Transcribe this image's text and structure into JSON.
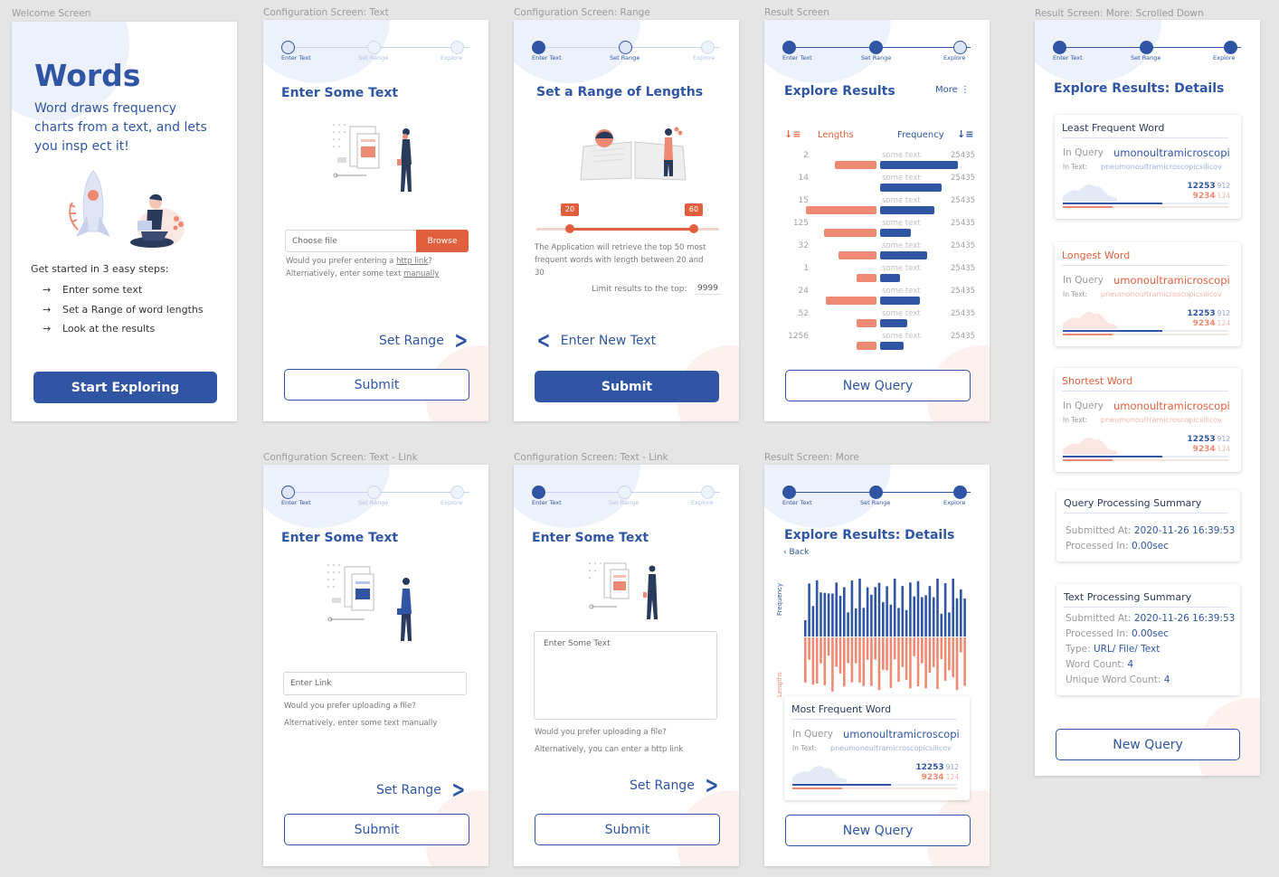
{
  "labels": {
    "welcome": "Welcome Screen",
    "cfg_text": "Configuration Screen: Text",
    "cfg_range": "Configuration Screen: Range",
    "result": "Result Screen",
    "result_scrolled": "Result Screen: More: Scrolled Down",
    "cfg_link": "Configuration Screen: Text - Link",
    "cfg_link2": "Configuration Screen: Text - Link",
    "result_more": "Result Screen: More"
  },
  "colors": {
    "primary": "#2f55a4",
    "accent": "#ee8a73"
  },
  "steps": {
    "s1": "Enter Text",
    "s2": "Set Range",
    "s3": "Explore"
  },
  "welcome": {
    "title": "Words",
    "subtitle_line1": "Word draws frequency",
    "subtitle_line2": "charts from a text, and lets",
    "subtitle_line3": "you insp ect it!",
    "steps_heading": "Get started in 3 easy steps:",
    "step1": "Enter some text",
    "step2": "Set a Range of word lengths",
    "step3": "Look at the results",
    "arrow": "→",
    "cta": "Start Exploring"
  },
  "text_screen": {
    "title": "Enter Some Text",
    "file_placeholder": "Choose file",
    "browse": "Browse",
    "hint1_pre": "Would you prefer entering a ",
    "hint1_link": "http link",
    "hint1_post": "?",
    "hint2_pre": "Alternatively, enter some text ",
    "hint2_link": "manually",
    "next": "Set Range",
    "submit": "Submit"
  },
  "range_screen": {
    "title": "Set a Range of Lengths",
    "min": "20",
    "max": "60",
    "desc1": "The Application will retrieve the top 50 most",
    "desc2": "frequent words with length between 20 and",
    "desc3": "30",
    "limit_label": "Limit results to the top:",
    "limit_value": "9999",
    "back": "Enter New Text",
    "submit": "Submit"
  },
  "result_screen": {
    "title": "Explore Results",
    "more": "More",
    "more_icon": "⋮",
    "col_lengths": "Lengths",
    "col_frequency": "Frequency",
    "row_text": "some text",
    "rows": [
      {
        "len": "2",
        "freq": "25435"
      },
      {
        "len": "14",
        "freq": "25435"
      },
      {
        "len": "15",
        "freq": "25435"
      },
      {
        "len": "125",
        "freq": "25435"
      },
      {
        "len": "32",
        "freq": "25435"
      },
      {
        "len": "1",
        "freq": "25435"
      },
      {
        "len": "24",
        "freq": "25435"
      },
      {
        "len": "52",
        "freq": "25435"
      },
      {
        "len": "1256",
        "freq": "25435"
      }
    ],
    "new_query": "New Query"
  },
  "link_screen": {
    "title": "Enter Some Text",
    "link_placeholder": "Enter Link",
    "hint1": "Would you prefer uploading a file?",
    "hint2": "Alternatively, enter some text manually",
    "next": "Set Range",
    "submit": "Submit"
  },
  "manual_screen": {
    "title": "Enter Some Text",
    "text_placeholder": "Enter Some Text",
    "hint1": "Would you prefer uploading a file?",
    "hint2": "Alternatively, you can enter a http link",
    "next": "Set Range",
    "submit": "Submit"
  },
  "more_screen": {
    "title": "Explore Results: Details",
    "back": "Back",
    "axis_freq": "Frequency",
    "axis_len": "Lengths",
    "card_title": "Most Frequent Word",
    "new_query": "New Query"
  },
  "word_card": {
    "in_query": "In Query",
    "word": "umonoultramicroscopi",
    "in_text": "In Text:",
    "text_word": "pneumonoultramicroscopicsilicov",
    "n1": "12253",
    "n1s": "912",
    "n2": "9234",
    "n2s": "124"
  },
  "scrolled_screen": {
    "title": "Explore Results: Details",
    "least": "Least Frequent Word",
    "longest": "Longest Word",
    "shortest": "Shortest Word",
    "qps_title": "Query Processing Summary",
    "qps_submitted_label": "Submitted At:",
    "qps_submitted": "2020-11-26 16:39:53",
    "qps_processed_label": "Processed In:",
    "qps_processed": "0.00sec",
    "tps_title": "Text Processing Summary",
    "tps_submitted_label": "Submitted At:",
    "tps_submitted": "2020-11-26 16:39:53",
    "tps_processed_label": "Processed In:",
    "tps_processed": "0.00sec",
    "tps_type_label": "Type:",
    "tps_type": "URL/ File/ Text",
    "tps_wc_label": "Word Count:",
    "tps_wc": "4",
    "tps_uwc_label": "Unique Word Count:",
    "tps_uwc": "4",
    "new_query": "New Query"
  }
}
